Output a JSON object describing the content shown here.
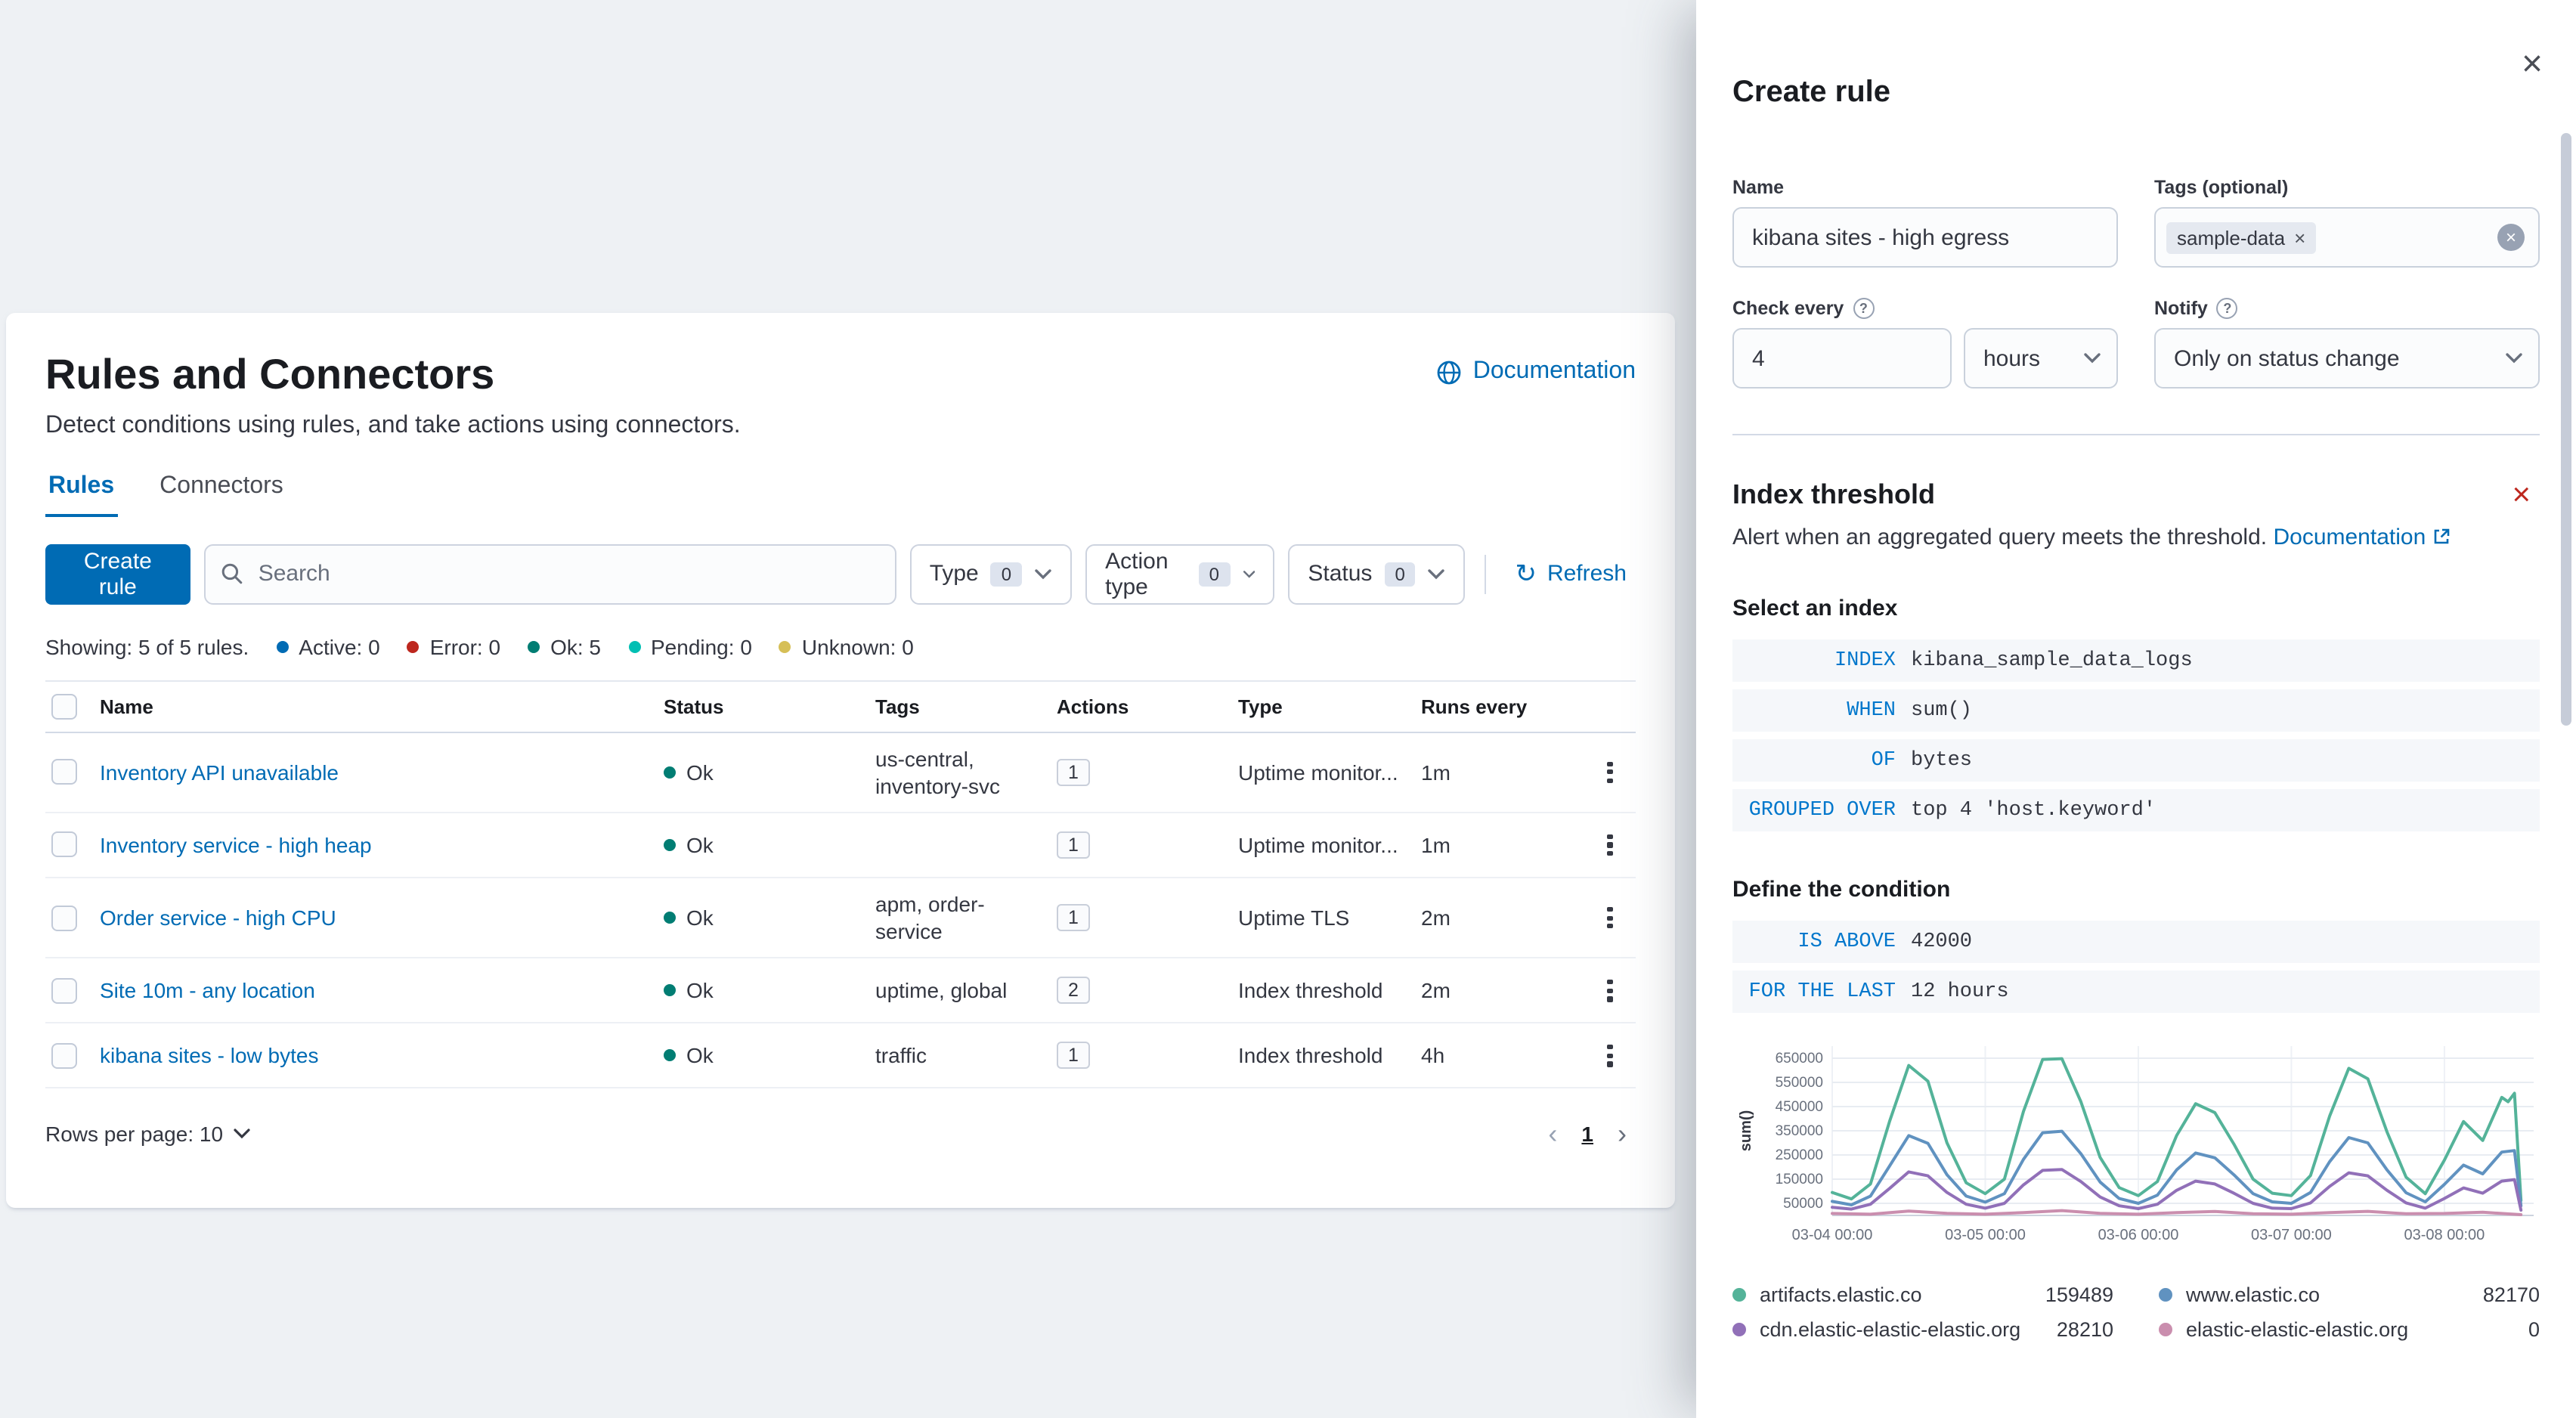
{
  "rules_page": {
    "title": "Rules and Connectors",
    "documentation_label": "Documentation",
    "subtitle": "Detect conditions using rules, and take actions using connectors.",
    "tabs": {
      "rules": "Rules",
      "connectors": "Connectors"
    },
    "create_rule_button": "Create rule",
    "search_placeholder": "Search",
    "filters": {
      "type": {
        "label": "Type",
        "count": "0"
      },
      "action_type": {
        "label": "Action type",
        "count": "0"
      },
      "status": {
        "label": "Status",
        "count": "0"
      }
    },
    "refresh_label": "Refresh",
    "refresh_glyph": "↻",
    "summary": {
      "showing": "Showing: 5 of 5 rules.",
      "statuses": [
        {
          "label": "Active: 0",
          "color": "#006BB4"
        },
        {
          "label": "Error: 0",
          "color": "#BD271E"
        },
        {
          "label": "Ok: 5",
          "color": "#017D73"
        },
        {
          "label": "Pending: 0",
          "color": "#00BFB3"
        },
        {
          "label": "Unknown: 0",
          "color": "#D6BF57"
        }
      ]
    },
    "table": {
      "headers": [
        "Name",
        "Status",
        "Tags",
        "Actions",
        "Type",
        "Runs every"
      ],
      "ok_dot_color": "#017D73",
      "rows": [
        {
          "name": "Inventory API unavailable",
          "status": "Ok",
          "tags": "us-central, inventory-svc",
          "actions": "1",
          "type": "Uptime monitor...",
          "runs_every": "1m"
        },
        {
          "name": "Inventory service - high heap",
          "status": "Ok",
          "tags": "",
          "actions": "1",
          "type": "Uptime monitor...",
          "runs_every": "1m"
        },
        {
          "name": "Order service - high CPU",
          "status": "Ok",
          "tags": "apm, order-service",
          "actions": "1",
          "type": "Uptime TLS",
          "runs_every": "2m"
        },
        {
          "name": "Site 10m - any location",
          "status": "Ok",
          "tags": "uptime, global",
          "actions": "2",
          "type": "Index threshold",
          "runs_every": "2m"
        },
        {
          "name": "kibana sites - low bytes",
          "status": "Ok",
          "tags": "traffic",
          "actions": "1",
          "type": "Index threshold",
          "runs_every": "4h"
        }
      ]
    },
    "pagination": {
      "rows_per_page": "Rows per page: 10",
      "page": "1",
      "prev": "‹",
      "next": "›"
    }
  },
  "flyout": {
    "title": "Create rule",
    "close_glyph": "×",
    "name_label": "Name",
    "name_value": "kibana sites - high egress",
    "tags_label": "Tags (optional)",
    "tag_chip": "sample-data",
    "tag_chip_remove": "×",
    "clear_glyph": "×",
    "check_every_label": "Check every",
    "check_every_value": "4",
    "check_every_unit": "hours",
    "notify_label": "Notify",
    "notify_value": "Only on status change",
    "help_glyph": "?",
    "rule_type": {
      "title": "Index threshold",
      "remove_glyph": "×",
      "description": "Alert when an aggregated query meets the threshold.",
      "documentation_label": "Documentation"
    },
    "select_index_heading": "Select an index",
    "expressions": [
      {
        "keyword": "INDEX",
        "value": "kibana_sample_data_logs"
      },
      {
        "keyword": "WHEN",
        "value": "sum()"
      },
      {
        "keyword": "OF",
        "value": "bytes"
      },
      {
        "keyword": "GROUPED OVER",
        "value": "top 4 'host.keyword'"
      }
    ],
    "condition_heading": "Define the condition",
    "conditions": [
      {
        "keyword": "IS ABOVE",
        "value": "42000"
      },
      {
        "keyword": "FOR THE LAST",
        "value": "12 hours"
      }
    ]
  },
  "chart_data": {
    "type": "line",
    "title": "",
    "xlabel": "",
    "ylabel": "sum()",
    "ylim": [
      0,
      700000
    ],
    "yticks": [
      50000,
      150000,
      250000,
      350000,
      450000,
      550000,
      650000
    ],
    "xlim_hours": [
      0,
      110
    ],
    "xticks_hours": [
      0,
      24,
      48,
      72,
      96
    ],
    "xtick_labels": [
      "03-04 00:00",
      "03-05 00:00",
      "03-06 00:00",
      "03-07 00:00",
      "03-08 00:00"
    ],
    "grid": true,
    "legend_position": "bottom",
    "series": [
      {
        "name": "artifacts.elastic.co",
        "color": "#54B399",
        "legend_value": "159489",
        "points": [
          [
            0,
            95000
          ],
          [
            3,
            68000
          ],
          [
            6,
            130000
          ],
          [
            9,
            390000
          ],
          [
            12,
            620000
          ],
          [
            15,
            555000
          ],
          [
            18,
            300000
          ],
          [
            21,
            135000
          ],
          [
            24,
            90000
          ],
          [
            27,
            150000
          ],
          [
            30,
            430000
          ],
          [
            33,
            645000
          ],
          [
            36,
            648000
          ],
          [
            39,
            470000
          ],
          [
            42,
            240000
          ],
          [
            45,
            115000
          ],
          [
            48,
            82000
          ],
          [
            51,
            140000
          ],
          [
            54,
            330000
          ],
          [
            57,
            462000
          ],
          [
            60,
            425000
          ],
          [
            63,
            295000
          ],
          [
            66,
            150000
          ],
          [
            69,
            92000
          ],
          [
            72,
            82000
          ],
          [
            75,
            165000
          ],
          [
            78,
            410000
          ],
          [
            81,
            608000
          ],
          [
            84,
            565000
          ],
          [
            87,
            345000
          ],
          [
            90,
            158000
          ],
          [
            93,
            90000
          ],
          [
            96,
            228000
          ],
          [
            99,
            388000
          ],
          [
            102,
            310000
          ],
          [
            105,
            488000
          ],
          [
            106,
            470000
          ],
          [
            107,
            505000
          ],
          [
            108,
            62000
          ]
        ]
      },
      {
        "name": "www.elastic.co",
        "color": "#6092C0",
        "legend_value": "82170",
        "points": [
          [
            0,
            58000
          ],
          [
            3,
            44000
          ],
          [
            6,
            80000
          ],
          [
            9,
            205000
          ],
          [
            12,
            330000
          ],
          [
            15,
            298000
          ],
          [
            18,
            168000
          ],
          [
            21,
            80000
          ],
          [
            24,
            55000
          ],
          [
            27,
            90000
          ],
          [
            30,
            232000
          ],
          [
            33,
            342000
          ],
          [
            36,
            348000
          ],
          [
            39,
            255000
          ],
          [
            42,
            138000
          ],
          [
            45,
            70000
          ],
          [
            48,
            50000
          ],
          [
            51,
            84000
          ],
          [
            54,
            188000
          ],
          [
            57,
            258000
          ],
          [
            60,
            238000
          ],
          [
            63,
            168000
          ],
          [
            66,
            90000
          ],
          [
            69,
            56000
          ],
          [
            72,
            50000
          ],
          [
            75,
            95000
          ],
          [
            78,
            222000
          ],
          [
            81,
            322000
          ],
          [
            84,
            300000
          ],
          [
            87,
            188000
          ],
          [
            90,
            94000
          ],
          [
            93,
            56000
          ],
          [
            96,
            128000
          ],
          [
            99,
            208000
          ],
          [
            102,
            172000
          ],
          [
            105,
            262000
          ],
          [
            107,
            268000
          ],
          [
            108,
            40000
          ]
        ]
      },
      {
        "name": "cdn.elastic-elastic-elastic.org",
        "color": "#9170B8",
        "legend_value": "28210",
        "points": [
          [
            0,
            34000
          ],
          [
            3,
            26000
          ],
          [
            6,
            46000
          ],
          [
            9,
            112000
          ],
          [
            12,
            180000
          ],
          [
            15,
            164000
          ],
          [
            18,
            95000
          ],
          [
            21,
            46000
          ],
          [
            24,
            30000
          ],
          [
            27,
            50000
          ],
          [
            30,
            126000
          ],
          [
            33,
            186000
          ],
          [
            36,
            190000
          ],
          [
            39,
            140000
          ],
          [
            42,
            76000
          ],
          [
            45,
            40000
          ],
          [
            48,
            28000
          ],
          [
            51,
            46000
          ],
          [
            54,
            104000
          ],
          [
            57,
            142000
          ],
          [
            60,
            130000
          ],
          [
            63,
            92000
          ],
          [
            66,
            50000
          ],
          [
            69,
            30000
          ],
          [
            72,
            28000
          ],
          [
            75,
            52000
          ],
          [
            78,
            120000
          ],
          [
            81,
            176000
          ],
          [
            84,
            164000
          ],
          [
            87,
            104000
          ],
          [
            90,
            52000
          ],
          [
            93,
            30000
          ],
          [
            96,
            70000
          ],
          [
            99,
            114000
          ],
          [
            102,
            92000
          ],
          [
            105,
            142000
          ],
          [
            107,
            148000
          ],
          [
            108,
            22000
          ]
        ]
      },
      {
        "name": "elastic-elastic-elastic.org",
        "color": "#CA8EAE",
        "legend_value": "0",
        "points": [
          [
            0,
            8000
          ],
          [
            6,
            5000
          ],
          [
            12,
            18000
          ],
          [
            18,
            9000
          ],
          [
            24,
            5000
          ],
          [
            30,
            12000
          ],
          [
            36,
            20000
          ],
          [
            42,
            9000
          ],
          [
            48,
            5000
          ],
          [
            54,
            12000
          ],
          [
            60,
            16000
          ],
          [
            66,
            7000
          ],
          [
            72,
            5000
          ],
          [
            78,
            12000
          ],
          [
            84,
            17000
          ],
          [
            90,
            7000
          ],
          [
            96,
            8000
          ],
          [
            102,
            13000
          ],
          [
            108,
            3000
          ]
        ]
      }
    ]
  }
}
